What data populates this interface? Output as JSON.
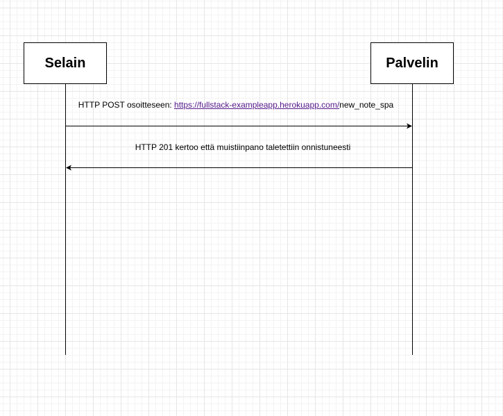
{
  "participants": [
    {
      "name": "Selain"
    },
    {
      "name": "Palvelin"
    }
  ],
  "messages": [
    {
      "from": "Selain",
      "to": "Palvelin",
      "prefix": "HTTP POST osoitteseen: ",
      "link": "https://fullstack-exampleapp.herokuapp.com/",
      "suffix": "new_note_spa"
    },
    {
      "from": "Palvelin",
      "to": "Selain",
      "text": "HTTP 201 kertoo että muistiinpano taletettiin onnistuneesti"
    }
  ],
  "colors": {
    "link": "#551a8b",
    "line": "#000000",
    "grid": "#e6e6e6"
  }
}
